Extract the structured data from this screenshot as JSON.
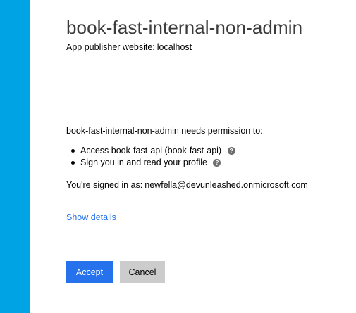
{
  "colors": {
    "accent_bar": "#00a4e4",
    "primary_button": "#2672ec",
    "link": "#2672ec",
    "secondary_button": "#cccccc"
  },
  "app": {
    "title": "book-fast-internal-non-admin",
    "publisher_label": "App publisher website:",
    "publisher_domain": "localhost"
  },
  "permissions": {
    "intro": "book-fast-internal-non-admin needs permission to:",
    "items": [
      {
        "label": "Access book-fast-api (book-fast-api)",
        "help_icon": "question-circle-icon",
        "help_glyph": "?"
      },
      {
        "label": "Sign you in and read your profile",
        "help_icon": "question-circle-icon",
        "help_glyph": "?"
      }
    ]
  },
  "account": {
    "label": "You're signed in as:",
    "email": "newfella@devunleashed.onmicrosoft.com"
  },
  "details": {
    "link_label": "Show details"
  },
  "actions": {
    "accept_label": "Accept",
    "cancel_label": "Cancel"
  }
}
